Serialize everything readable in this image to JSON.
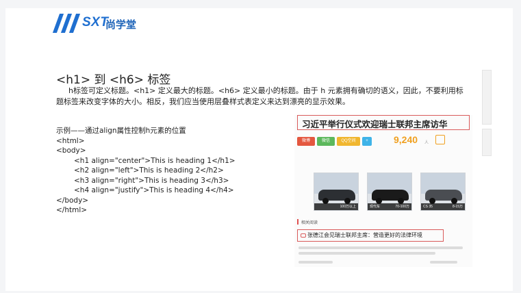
{
  "brand": {
    "logo_text": "SXT",
    "logo_cn": "尚学堂",
    "accent": "#1f6fd0"
  },
  "slide": {
    "heading": "<h1> 到 <h6> 标签",
    "intro": "h标签可定义标题。<h1> 定义最大的标题。<h6> 定义最小的标题。由于 h 元素拥有确切的语义，因此，不要利用标题标签来改变字体的大小。相反，我们应当使用层叠样式表定义来达到漂亮的显示效果。",
    "code_lines": [
      "示例——通过align属性控制h元素的位置",
      "<html>",
      "<body>",
      "<h1 align=\"center\">This is heading 1</h1>",
      "<h2 align=\"left\">This is heading 2</h2>",
      "<h3 align=\"right\">This is heading 3</h3>",
      "<h4 align=\"justify\">This is heading 4</h4>",
      "</body>",
      "</html>"
    ]
  },
  "news": {
    "title": "习近平举行仪式欢迎瑞士联邦主席访华",
    "share_count": "9,240",
    "count_unit": "人",
    "share_buttons": [
      "微博",
      "微信",
      "QQ空间",
      "+"
    ],
    "cars": [
      {
        "caption_left": "",
        "caption_right": "100万以上"
      },
      {
        "caption_left": "现代车",
        "caption_right": "70-100万"
      },
      {
        "caption_left": "CS 35",
        "caption_right": "8-15万"
      }
    ],
    "related_label": "相关阅读",
    "related_headline": "张德江会见瑞士联邦主席：营造更好的法律环境"
  }
}
